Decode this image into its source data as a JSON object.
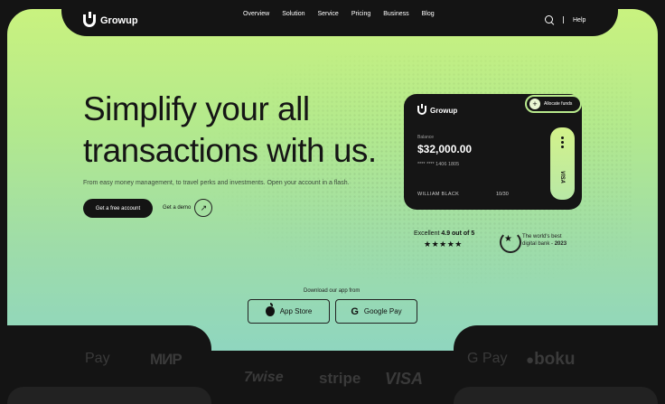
{
  "brand": {
    "name": "Growup"
  },
  "nav": {
    "items": [
      "Overview",
      "Solution",
      "Service",
      "Pricing",
      "Business",
      "Blog"
    ],
    "help_label": "Help"
  },
  "hero": {
    "headline_line1": "Simplify your all",
    "headline_line2": "transactions with us.",
    "subtext": "From easy money management, to travel perks and investments. Open your account in a flash.",
    "primary_button": "Get a free account",
    "demo_label": "Get a demo"
  },
  "card": {
    "brand": "Growup",
    "balance_label": "Balance",
    "balance_value": "$32,000.00",
    "card_number": "**** **** 1406 1805",
    "holder": "WILLIAM BLACK",
    "expiry": "10/30",
    "network": "VISA",
    "allocate_label": "Allocate funds",
    "accent_color": "#c8f07f"
  },
  "rating": {
    "prefix": "Excellent",
    "score": "4.9 out of 5",
    "stars": "★★★★★",
    "stars_value": 5
  },
  "award": {
    "line1": "The world's best",
    "line2_prefix": "digital bank - ",
    "year": "2023"
  },
  "download": {
    "label": "Download our app from",
    "app_store": "App Store",
    "google_play": "Google Pay"
  },
  "partners": {
    "apple_pay": "Pay",
    "mir": "МИР",
    "google_pay": "G Pay",
    "boku": "boku",
    "wise": "7wise",
    "stripe": "stripe",
    "visa": "VISA"
  }
}
